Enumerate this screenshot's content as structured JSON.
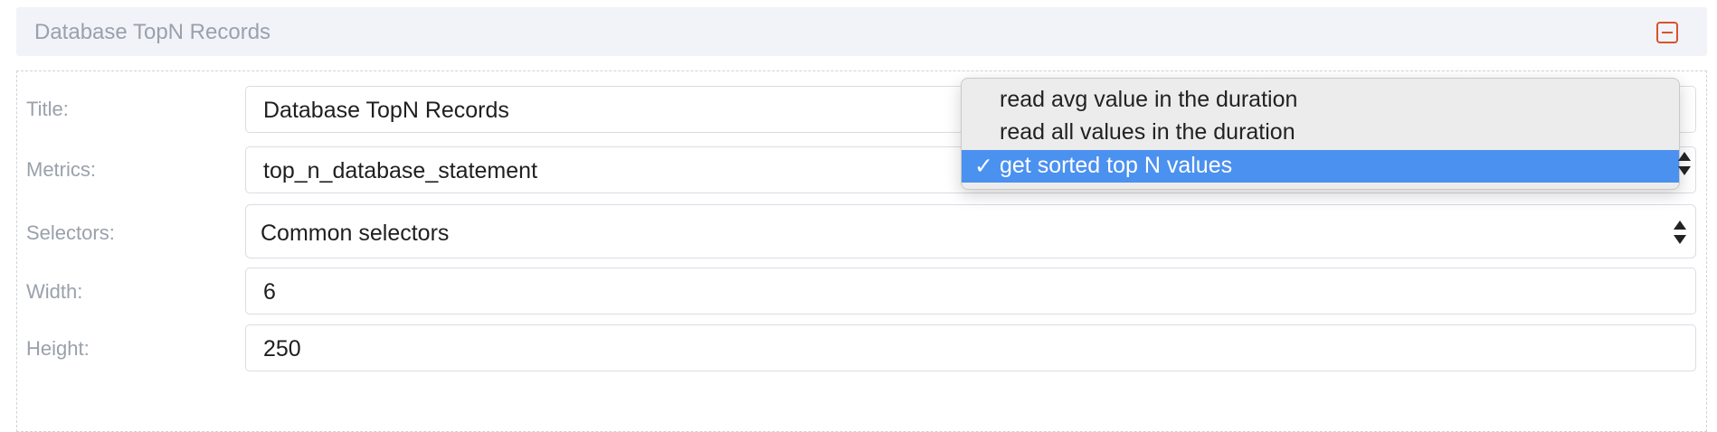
{
  "panel": {
    "title": "Database TopN Records",
    "collapse_icon": "minus-square-icon",
    "accent_color": "#d9532c"
  },
  "form": {
    "title_label": "Title:",
    "title_value": "Database TopN Records",
    "metrics_label": "Metrics:",
    "metrics_value": "top_n_database_statement",
    "selectors_label": "Selectors:",
    "selectors_value": "Common selectors",
    "width_label": "Width:",
    "width_value": "6",
    "height_label": "Height:",
    "height_value": "250"
  },
  "dropdown": {
    "options": [
      "read avg value in the duration",
      "read all values in the duration",
      "get sorted top N values"
    ],
    "selected_index": 2,
    "check_glyph": "✓",
    "selected_color": "#4b91ef"
  }
}
